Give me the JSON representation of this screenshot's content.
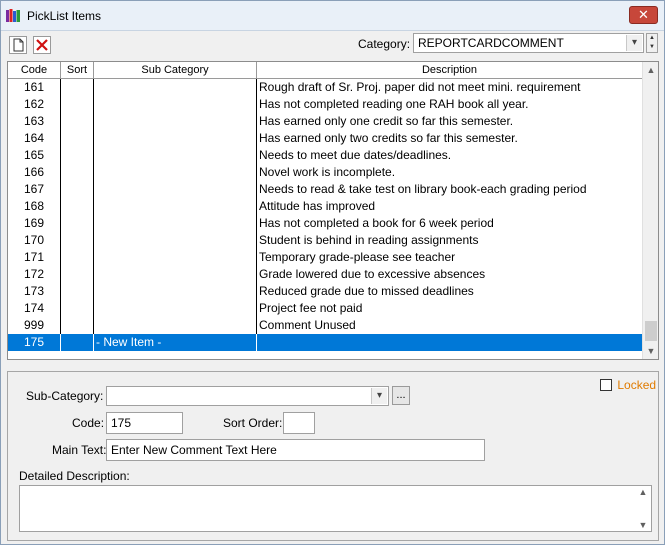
{
  "window": {
    "title": "PickList Items",
    "close_label": "✕"
  },
  "toolbar": {
    "category_label": "Category:",
    "category_value": "REPORTCARDCOMMENT"
  },
  "grid": {
    "columns": [
      "Code",
      "Sort",
      "Sub Category",
      "Description"
    ],
    "rows": [
      {
        "code": "161",
        "sort": "",
        "sub": "",
        "desc": "Rough draft of Sr. Proj. paper did not meet mini. requirement"
      },
      {
        "code": "162",
        "sort": "",
        "sub": "",
        "desc": "Has not completed reading one RAH book all year."
      },
      {
        "code": "163",
        "sort": "",
        "sub": "",
        "desc": "Has earned only one credit so far this semester."
      },
      {
        "code": "164",
        "sort": "",
        "sub": "",
        "desc": "Has earned only two credits so far this semester."
      },
      {
        "code": "165",
        "sort": "",
        "sub": "",
        "desc": "Needs to meet due dates/deadlines."
      },
      {
        "code": "166",
        "sort": "",
        "sub": "",
        "desc": "Novel work is incomplete."
      },
      {
        "code": "167",
        "sort": "",
        "sub": "",
        "desc": "Needs to read & take test on library book-each grading period"
      },
      {
        "code": "168",
        "sort": "",
        "sub": "",
        "desc": "Attitude has improved"
      },
      {
        "code": "169",
        "sort": "",
        "sub": "",
        "desc": "Has not completed a book for 6 week period"
      },
      {
        "code": "170",
        "sort": "",
        "sub": "",
        "desc": "Student is behind in reading assignments"
      },
      {
        "code": "171",
        "sort": "",
        "sub": "",
        "desc": "Temporary grade-please see teacher"
      },
      {
        "code": "172",
        "sort": "",
        "sub": "",
        "desc": "Grade lowered due to excessive absences"
      },
      {
        "code": "173",
        "sort": "",
        "sub": "",
        "desc": "Reduced grade due to missed deadlines"
      },
      {
        "code": "174",
        "sort": "",
        "sub": "",
        "desc": "Project fee not paid"
      },
      {
        "code": "999",
        "sort": "",
        "sub": "",
        "desc": "Comment Unused"
      },
      {
        "code": "175",
        "sort": "",
        "sub": "- New Item -",
        "desc": "",
        "selected": true
      }
    ]
  },
  "detail": {
    "locked_label": "Locked",
    "subcategory_label": "Sub-Category:",
    "subcategory_value": "",
    "ellipsis_label": "...",
    "code_label": "Code:",
    "code_value": "175",
    "sortorder_label": "Sort Order:",
    "sortorder_value": "",
    "maintext_label": "Main Text:",
    "maintext_value": "Enter New Comment Text Here",
    "detailed_label": "Detailed Description:",
    "detailed_value": ""
  },
  "colors": {
    "selection": "#0078d7",
    "locked": "#e07b00",
    "close": "#c7473a"
  },
  "icons": [
    "books-icon",
    "new-document-icon",
    "delete-x-icon",
    "chevron-down-icon",
    "chevron-up-icon",
    "close-icon"
  ]
}
